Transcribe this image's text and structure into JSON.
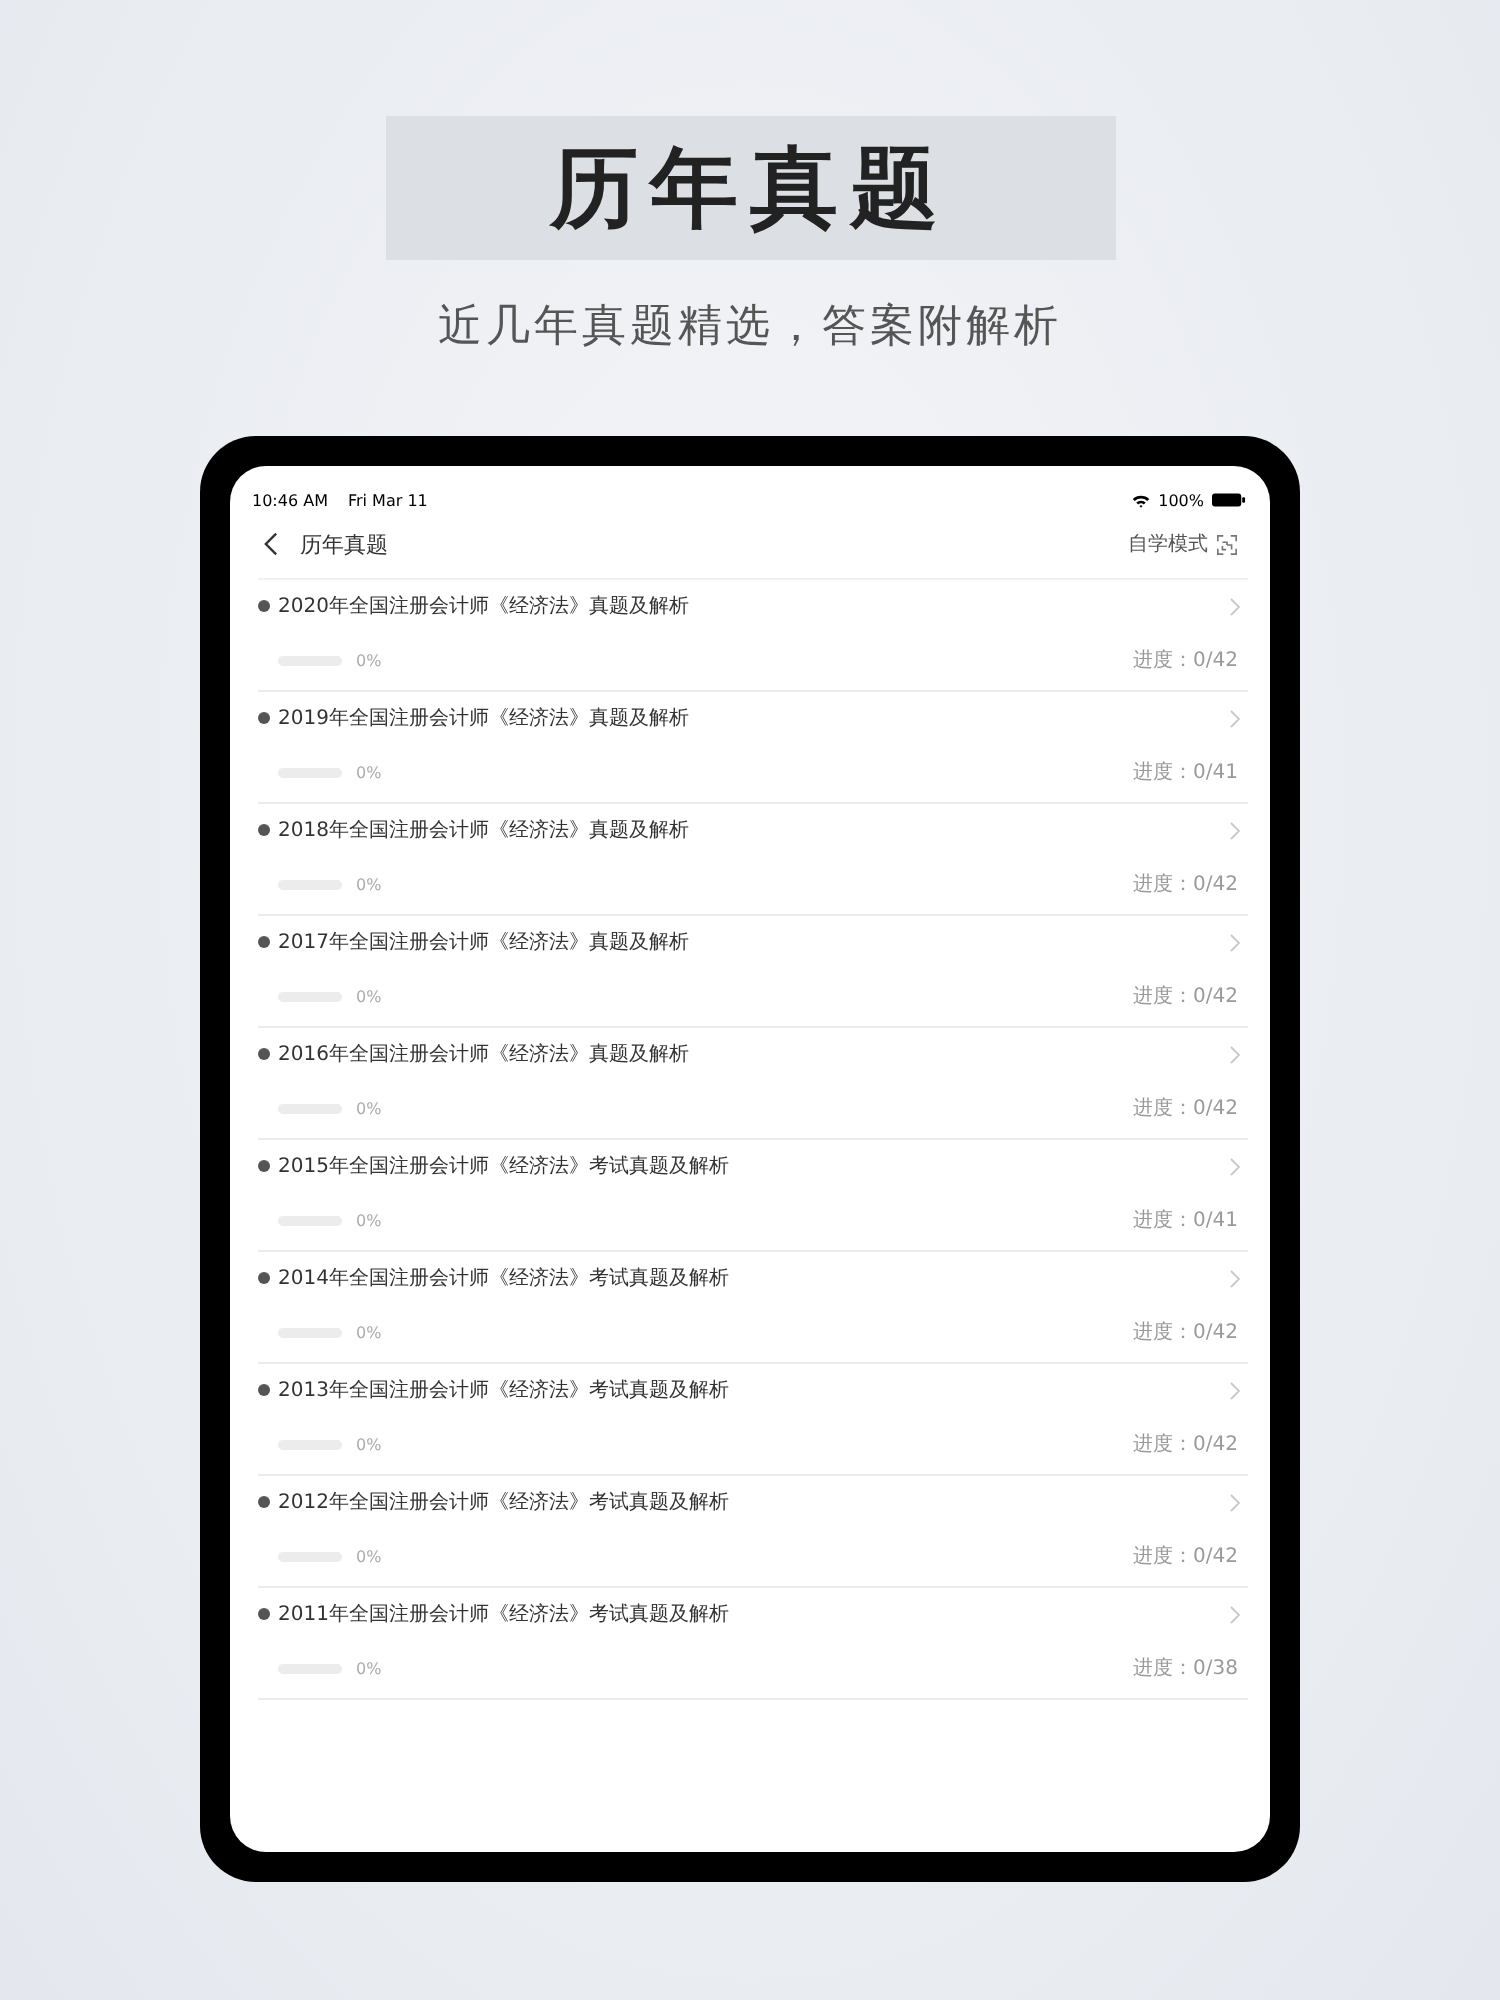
{
  "headline": "历年真题",
  "subtitle": "近几年真题精选，答案附解析",
  "status_bar": {
    "time": "10:46 AM",
    "date": "Fri Mar 11",
    "battery": "100%"
  },
  "nav": {
    "title": "历年真题",
    "mode": "自学模式"
  },
  "rows": [
    {
      "title": "2020年全国注册会计师《经济法》真题及解析",
      "level": 0,
      "percent": "0%",
      "progress": "进度：0/42"
    },
    {
      "title": "2019年全国注册会计师《经济法》真题及解析",
      "level": 0,
      "percent": "0%",
      "progress": "进度：0/41"
    },
    {
      "title": "2018年全国注册会计师《经济法》真题及解析",
      "level": 0,
      "percent": "0%",
      "progress": "进度：0/42"
    },
    {
      "title": "2017年全国注册会计师《经济法》真题及解析",
      "level": 0,
      "percent": "0%",
      "progress": "进度：0/42"
    },
    {
      "title": "2016年全国注册会计师《经济法》真题及解析",
      "level": 0,
      "percent": "0%",
      "progress": "进度：0/42"
    },
    {
      "title": "2015年全国注册会计师《经济法》考试真题及解析",
      "level": 0,
      "percent": "0%",
      "progress": "进度：0/41"
    },
    {
      "title": "2014年全国注册会计师《经济法》考试真题及解析",
      "level": 0,
      "percent": "0%",
      "progress": "进度：0/42"
    },
    {
      "title": "2013年全国注册会计师《经济法》考试真题及解析",
      "level": 0,
      "percent": "0%",
      "progress": "进度：0/42"
    },
    {
      "title": "2012年全国注册会计师《经济法》考试真题及解析",
      "level": 0,
      "percent": "0%",
      "progress": "进度：0/42"
    },
    {
      "title": "2011年全国注册会计师《经济法》考试真题及解析",
      "level": 0,
      "percent": "0%",
      "progress": "进度：0/38"
    }
  ]
}
